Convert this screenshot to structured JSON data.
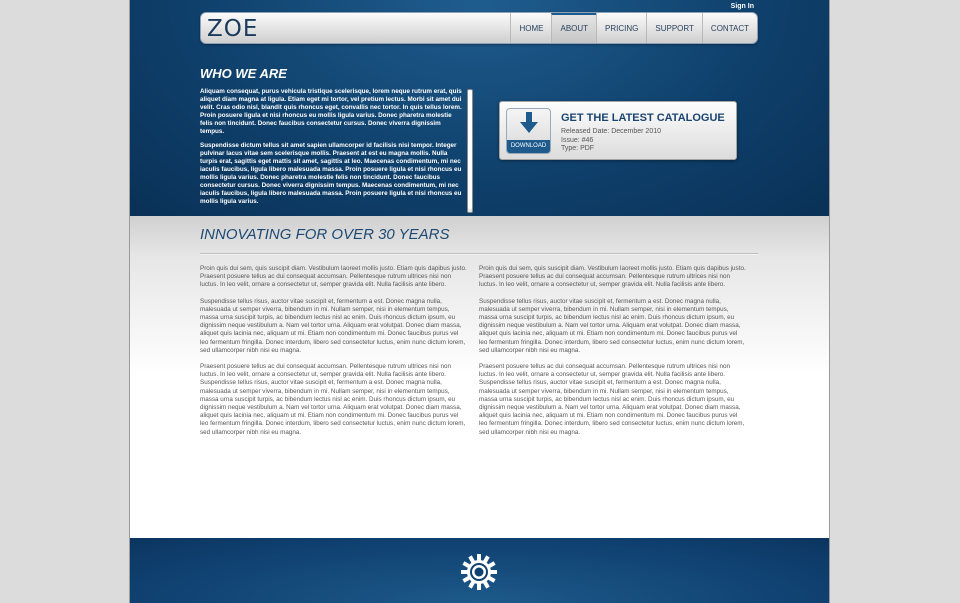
{
  "header": {
    "signin": "Sign In",
    "logo": "ZOE",
    "nav": [
      {
        "label": "HOME"
      },
      {
        "label": "ABOUT"
      },
      {
        "label": "PRICING"
      },
      {
        "label": "SUPPORT"
      },
      {
        "label": "CONTACT"
      }
    ],
    "active_nav": "ABOUT"
  },
  "who": {
    "title": "WHO WE ARE",
    "paragraphs": [
      "Aliquam consequat, purus vehicula tristique scelerisque, lorem neque rutrum erat, quis aliquet diam magna at ligula. Etiam eget mi tortor, vel pretium lectus. Morbi sit amet dui velit. Cras odio nisl, blandit quis rhoncus eget, convallis nec tortor. In quis tellus lorem. Proin posuere ligula et nisi rhoncus eu mollis ligula varius. Donec pharetra molestie felis non tincidunt. Donec faucibus consectetur cursus. Donec viverra dignissim tempus.",
      "Suspendisse dictum tellus sit amet sapien ullamcorper id facilisis nisi tempor. Integer pulvinar lacus vitae sem scelerisque mollis. Praesent at est eu magna mollis. Nulla turpis erat, sagittis eget mattis sit amet, sagittis at leo. Maecenas condimentum, mi nec iaculis faucibus, ligula libero malesuada massa. Proin posuere ligula et nisi rhoncus eu mollis ligula varius. Donec pharetra molestie felis non tincidunt. Donec faucibus consectetur cursus. Donec viverra dignissim tempus. Maecenas condimentum, mi nec iaculis faucibus, ligula libero malesuada massa. Proin posuere ligula et nisi rhoncus eu mollis ligula varius."
    ]
  },
  "catalogue": {
    "title": "GET THE LATEST CATALOGUE",
    "download_label": "DOWNLOAD",
    "release": "Released Date: December 2010",
    "issue": "Issue: #46",
    "type": "Type: PDF",
    "icon": "download-arrow-icon"
  },
  "innovating": {
    "title": "INNOVATING FOR OVER 30 YEARS",
    "columns": [
      [
        "Proin quis dui sem, quis suscipit diam. Vestibulum laoreet mollis justo. Etiam quis dapibus justo. Praesent posuere tellus ac dui consequat accumsan. Pellentesque rutrum ultrices nisi non luctus. In leo velit, ornare a consectetur ut, semper gravida elit. Nulla facilisis ante libero.",
        "Suspendisse tellus risus, auctor vitae suscipit et, fermentum a est. Donec magna nulla, malesuada ut semper viverra, bibendum in mi. Nullam semper, nisi in elementum tempus, massa urna suscipit turpis, ac bibendum lectus nisl ac enim. Duis rhoncus dictum ipsum, eu dignissim neque vestibulum a. Nam vel tortor urna. Aliquam erat volutpat. Donec diam massa, aliquet quis lacinia nec, aliquam ut mi. Etiam non condimentum mi. Donec faucibus purus vel leo fermentum fringilla. Donec interdum, libero sed consectetur luctus, enim nunc dictum lorem, sed ullamcorper nibh nisi eu magna.",
        "Praesent posuere tellus ac dui consequat accumsan. Pellentesque rutrum ultrices nisi non luctus. In leo velit, ornare a consectetur ut, semper gravida elit. Nulla facilisis ante libero. Suspendisse tellus risus, auctor vitae suscipit et, fermentum a est. Donec magna nulla, malesuada ut semper viverra, bibendum in mi. Nullam semper, nisi in elementum tempus, massa urna suscipit turpis, ac bibendum lectus nisl ac enim. Duis rhoncus dictum ipsum, eu dignissim neque vestibulum a. Nam vel tortor urna. Aliquam erat volutpat. Donec diam massa, aliquet quis lacinia nec, aliquam ut mi. Etiam non condimentum mi. Donec faucibus purus vel leo fermentum fringilla. Donec interdum, libero sed consectetur luctus, enim nunc dictum lorem, sed ullamcorper nibh nisi eu magna."
      ],
      [
        "Proin quis dui sem, quis suscipit diam. Vestibulum laoreet mollis justo. Etiam quis dapibus justo. Praesent posuere tellus ac dui consequat accumsan. Pellentesque rutrum ultrices nisi non luctus. In leo velit, ornare a consectetur ut, semper gravida elit. Nulla facilisis ante libero.",
        "Suspendisse tellus risus, auctor vitae suscipit et, fermentum a est. Donec magna nulla, malesuada ut semper viverra, bibendum in mi. Nullam semper, nisi in elementum tempus, massa urna suscipit turpis, ac bibendum lectus nisl ac enim. Duis rhoncus dictum ipsum, eu dignissim neque vestibulum a. Nam vel tortor urna. Aliquam erat volutpat. Donec diam massa, aliquet quis lacinia nec, aliquam ut mi. Etiam non condimentum mi. Donec faucibus purus vel leo fermentum fringilla. Donec interdum, libero sed consectetur luctus, enim nunc dictum lorem, sed ullamcorper nibh nisi eu magna.",
        "Praesent posuere tellus ac dui consequat accumsan. Pellentesque rutrum ultrices nisi non luctus. In leo velit, ornare a consectetur ut, semper gravida elit. Nulla facilisis ante libero. Suspendisse tellus risus, auctor vitae suscipit et, fermentum a est. Donec magna nulla, malesuada ut semper viverra, bibendum in mi. Nullam semper, nisi in elementum tempus, massa urna suscipit turpis, ac bibendum lectus nisl ac enim. Duis rhoncus dictum ipsum, eu dignissim neque vestibulum a. Nam vel tortor urna. Aliquam erat volutpat. Donec diam massa, aliquet quis lacinia nec, aliquam ut mi. Etiam non condimentum mi. Donec faucibus purus vel leo fermentum fringilla. Donec interdum, libero sed consectetur luctus, enim nunc dictum lorem, sed ullamcorper nibh nisi eu magna."
      ]
    ]
  },
  "footer": {
    "icon": "gear-icon"
  },
  "colors": {
    "brand_blue": "#0e3f6a",
    "heading_blue": "#1d4a75",
    "download_blue": "#1e5a8c"
  }
}
